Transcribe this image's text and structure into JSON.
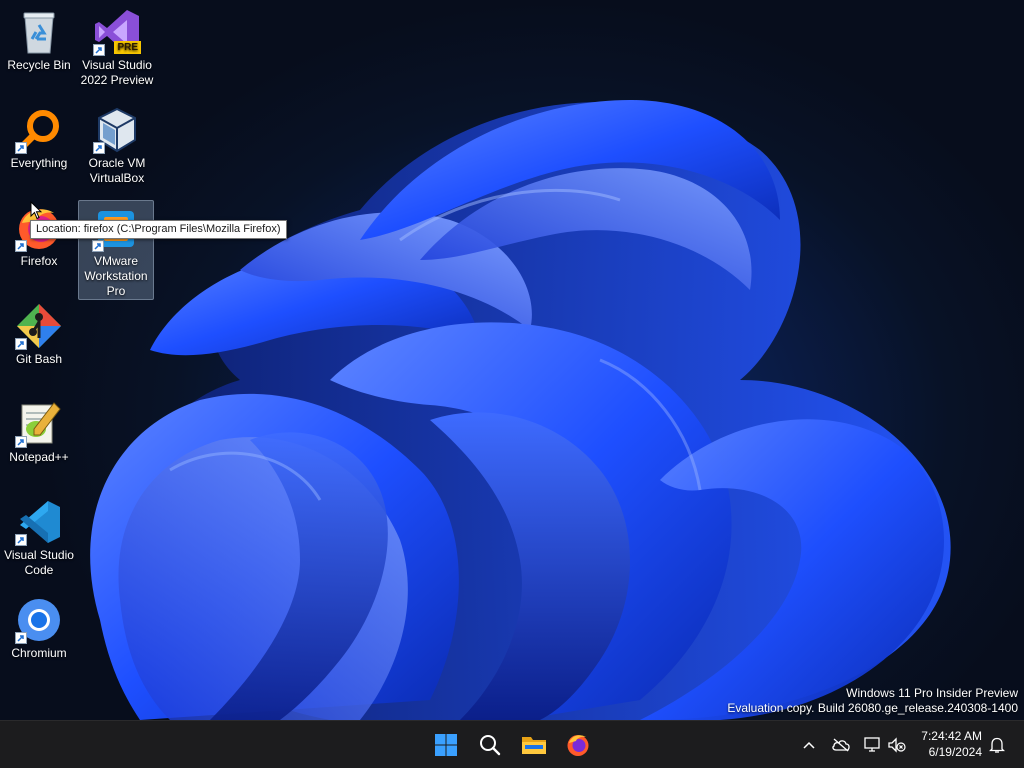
{
  "desktop": {
    "icons": [
      {
        "label": "Recycle Bin"
      },
      {
        "label": "Visual Studio\n2022 Preview",
        "badge": "PRE"
      },
      {
        "label": "Everything"
      },
      {
        "label": "Oracle VM\nVirtualBox"
      },
      {
        "label": "Firefox"
      },
      {
        "label": "VMware\nWorkstation\nPro"
      },
      {
        "label": "Git Bash"
      },
      {
        "label": "Notepad++"
      },
      {
        "label": "Visual Studio\nCode"
      },
      {
        "label": "Chromium"
      }
    ],
    "tooltip": "Location: firefox (C:\\Program Files\\Mozilla Firefox)",
    "selected_icon": "VMware Workstation Pro"
  },
  "watermark": {
    "line1": "Windows 11 Pro Insider Preview",
    "line2": "Evaluation copy. Build 26080.ge_release.240308-1400"
  },
  "taskbar": {
    "pinned": [
      "start-icon",
      "search-icon",
      "file-explorer-icon",
      "firefox-icon"
    ],
    "tray_icons": [
      "chevron-up-icon",
      "onedrive-icon",
      "network-icon",
      "volume-muted-icon",
      "notification-bell-icon"
    ],
    "clock": {
      "time": "7:24:42 AM",
      "date": "6/19/2024"
    }
  },
  "colors": {
    "taskbar_bg": "#1c1c1e",
    "wallpaper_accent": "#1e4fff",
    "win_blue": "#3aa0ff"
  }
}
